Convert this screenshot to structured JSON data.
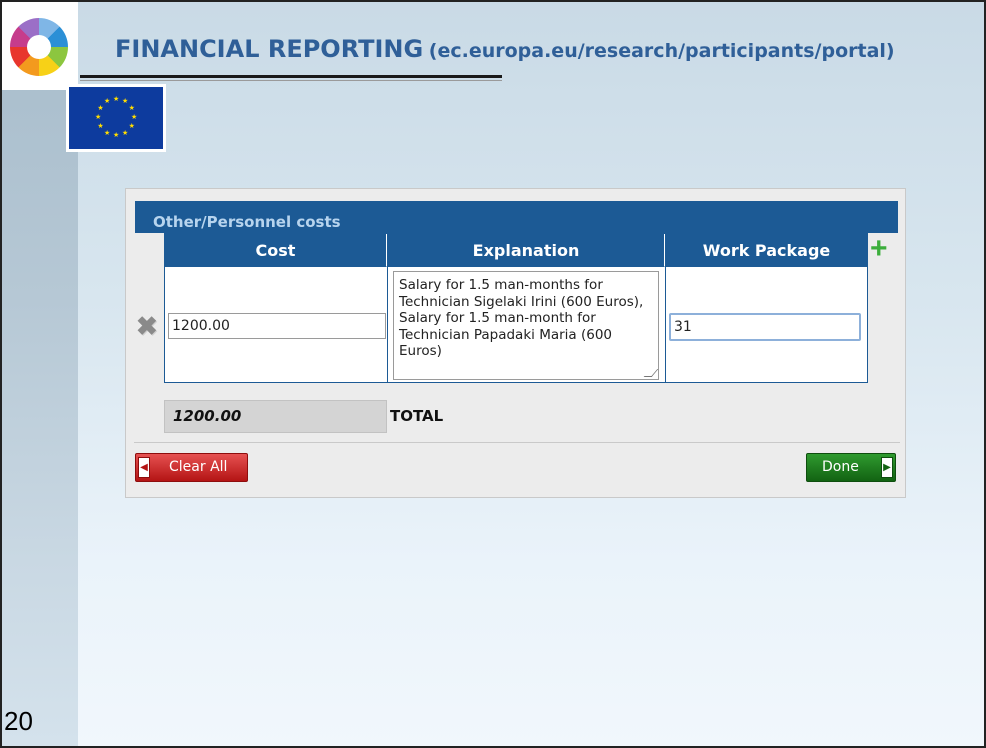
{
  "slide": {
    "title_main": "FINANCIAL REPORTING",
    "title_sub": "(ec.europa.eu/research/participants/portal)",
    "number": "20"
  },
  "dialog": {
    "header": "Other/Personnel costs",
    "columns": [
      "Cost",
      "Explanation",
      "Work Package"
    ],
    "row": {
      "cost": "1200.00",
      "explanation": "Salary for 1.5 man-months for Technician Sigelaki Irini (600 Euros), Salary for 1.5 man-month  for Technician Papadaki Maria (600 Euros)",
      "work_package": "31"
    },
    "total_value": "1200.00",
    "total_label": "TOTAL",
    "clear_all_label": "Clear All",
    "done_label": "Done"
  },
  "icons": {
    "delete": "close-icon",
    "add": "plus-icon",
    "logo": "color-ring-logo-icon",
    "flag": "eu-flag-icon"
  },
  "colors": {
    "header_blue": "#1c5a95",
    "title_blue": "#2f5f98",
    "clear_red": "#b41414",
    "done_green": "#126312",
    "add_green": "#3cae3c"
  }
}
